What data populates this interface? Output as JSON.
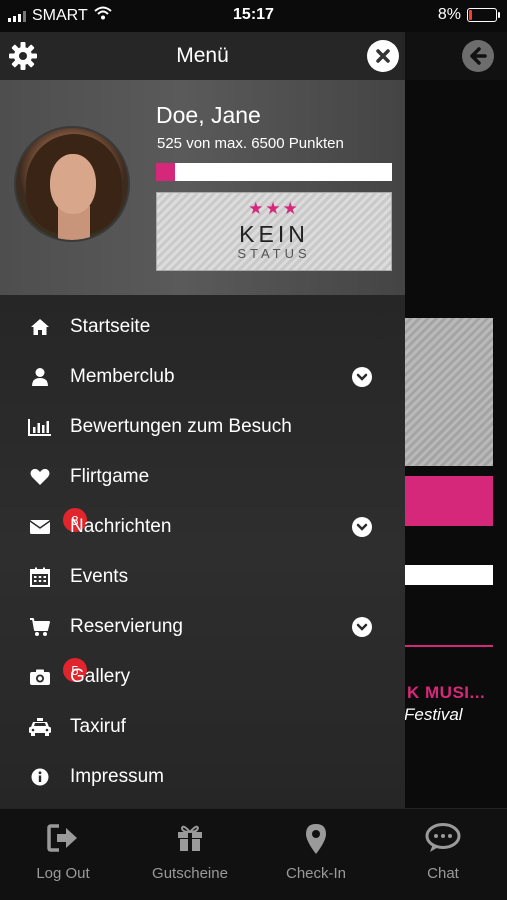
{
  "status_bar": {
    "carrier": "SMART",
    "time": "15:17",
    "battery": "8%"
  },
  "drawer": {
    "title": "Menü",
    "profile": {
      "name": "Doe, Jane",
      "points_text": "525  von max. 6500 Punkten",
      "points": 525,
      "max_points": 6500,
      "status_title": "KEIN",
      "status_subtitle": "STATUS"
    },
    "menu": [
      {
        "label": "Startseite",
        "icon": "home-icon"
      },
      {
        "label": "Memberclub",
        "icon": "user-icon",
        "expandable": true
      },
      {
        "label": "Bewertungen zum Besuch",
        "icon": "bar-chart-icon"
      },
      {
        "label": "Flirtgame",
        "icon": "heart-icon"
      },
      {
        "label": "Nachrichten",
        "icon": "envelope-icon",
        "badge": "8",
        "expandable": true
      },
      {
        "label": "Events",
        "icon": "calendar-icon"
      },
      {
        "label": "Reservierung",
        "icon": "cart-icon",
        "expandable": true
      },
      {
        "label": "Gallery",
        "icon": "camera-icon",
        "badge": "5"
      },
      {
        "label": "Taxiruf",
        "icon": "taxi-icon"
      },
      {
        "label": "Impressum",
        "icon": "info-icon"
      }
    ]
  },
  "background": {
    "music_text": "K MUSI...",
    "festival_text": "Festival"
  },
  "tabbar": [
    {
      "label": "Log Out",
      "icon": "logout-icon"
    },
    {
      "label": "Gutscheine",
      "icon": "gift-icon"
    },
    {
      "label": "Check-In",
      "icon": "location-pin-icon"
    },
    {
      "label": "Chat",
      "icon": "chat-bubble-icon"
    }
  ],
  "colors": {
    "accent": "#d6287a",
    "badge": "#e0262c",
    "drawer_bg": "#2a2a2a",
    "tabbar_bg": "#111111"
  }
}
